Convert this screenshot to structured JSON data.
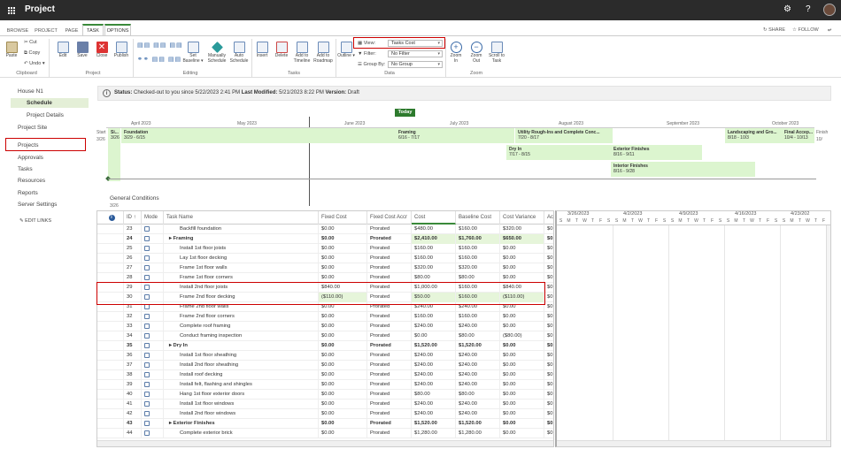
{
  "app": {
    "title": "Project"
  },
  "tabs": [
    "BROWSE",
    "PROJECT",
    "PAGE",
    "TASK",
    "OPTIONS"
  ],
  "tab_right": {
    "share": "SHARE",
    "follow": "FOLLOW"
  },
  "ribbon": {
    "clipboard": {
      "paste": "Paste",
      "cut": "Cut",
      "copy": "Copy",
      "undo": "Undo",
      "label": "Clipboard"
    },
    "project": {
      "edit": "Edit",
      "save": "Save",
      "close": "Close",
      "publish": "Publish",
      "label": "Project"
    },
    "editing": {
      "set_baseline": "Set Baseline",
      "manually": "Manually Schedule",
      "auto": "Auto Schedule",
      "label": "Editing"
    },
    "tasks": {
      "insert": "Insert",
      "delete": "Delete",
      "add_timeline": "Add to Timeline",
      "add_roadmap": "Add to Roadmap",
      "label": "Tasks"
    },
    "data": {
      "outline": "Outline",
      "view_label": "View:",
      "view_value": "Tasks Cost",
      "filter_label": "Filter:",
      "filter_value": "No Filter",
      "group_label": "Group By:",
      "group_value": "No Group",
      "label": "Data"
    },
    "zoom": {
      "zoom_in": "Zoom In",
      "zoom_out": "Zoom Out",
      "scroll": "Scroll to Task",
      "label": "Zoom"
    }
  },
  "nav": {
    "items": [
      "House N1",
      "Schedule",
      "Project Details",
      "Project Site",
      "Projects",
      "Approvals",
      "Tasks",
      "Resources",
      "Reports",
      "Server Settings",
      "EDIT LINKS"
    ]
  },
  "status": {
    "l1": "Status:",
    "v1": "Checked-out to you since 5/22/2023 2:41 PM",
    "l2": "Last Modified:",
    "v2": "5/21/2023 8:22 PM",
    "l3": "Version:",
    "v3": "Draft"
  },
  "timeline": {
    "today": "Today",
    "start_label": "Start",
    "start_date": "3/26",
    "finish_label": "Finish",
    "finish_date": "10/",
    "months": [
      "April 2023",
      "May 2023",
      "June 2023",
      "July 2023",
      "August 2023",
      "September 2023",
      "October 2023"
    ],
    "bars": [
      {
        "name": "Si...",
        "date": "3/26"
      },
      {
        "name": "Foundation",
        "date": "3/29 - 6/15"
      },
      {
        "name": "Framing",
        "date": "6/16 - 7/17"
      },
      {
        "name": "Utility Rough-Ins and Complete Conc...",
        "date": "7/20 - 8/17"
      },
      {
        "name": "Landscaping and Gro...",
        "date": "8/18 - 10/3"
      },
      {
        "name": "Final Accep...",
        "date": "10/4 - 10/13"
      },
      {
        "name": "Dry In",
        "date": "7/17 - 8/15"
      },
      {
        "name": "Exterior Finishes",
        "date": "8/16 - 9/11"
      },
      {
        "name": "Interior Finishes",
        "date": "8/16 - 9/28"
      }
    ],
    "general": "General Conditions",
    "general_date": "3/26"
  },
  "grid": {
    "headers": [
      "",
      "ID ↑",
      "Mode",
      "Task Name",
      "Fixed Cost",
      "Fixed Cost Accr",
      "Cost",
      "Baseline Cost",
      "Cost Variance",
      "Ac"
    ],
    "rows": [
      {
        "id": "23",
        "name": "Backfill foundation",
        "fc": "$0.00",
        "acc": "Prorated",
        "cost": "$480.00",
        "base": "$160.00",
        "var": "$320.00",
        "ac": "$0."
      },
      {
        "id": "24",
        "name": "▸ Framing",
        "fc": "$0.00",
        "acc": "Prorated",
        "cost": "$2,410.00",
        "base": "$1,760.00",
        "var": "$650.00",
        "ac": "$0.",
        "bold": true,
        "hl": true
      },
      {
        "id": "25",
        "name": "Install 1st floor joists",
        "fc": "$0.00",
        "acc": "Prorated",
        "cost": "$160.00",
        "base": "$160.00",
        "var": "$0.00",
        "ac": "$0."
      },
      {
        "id": "26",
        "name": "Lay 1st floor decking",
        "fc": "$0.00",
        "acc": "Prorated",
        "cost": "$160.00",
        "base": "$160.00",
        "var": "$0.00",
        "ac": "$0."
      },
      {
        "id": "27",
        "name": "Frame 1st floor walls",
        "fc": "$0.00",
        "acc": "Prorated",
        "cost": "$320.00",
        "base": "$320.00",
        "var": "$0.00",
        "ac": "$0."
      },
      {
        "id": "28",
        "name": "Frame 1st floor corners",
        "fc": "$0.00",
        "acc": "Prorated",
        "cost": "$80.00",
        "base": "$80.00",
        "var": "$0.00",
        "ac": "$0."
      },
      {
        "id": "29",
        "name": "Install 2nd floor joists",
        "fc": "$840.00",
        "acc": "Prorated",
        "cost": "$1,000.00",
        "base": "$160.00",
        "var": "$840.00",
        "ac": "$0."
      },
      {
        "id": "30",
        "name": "Frame 2nd floor decking",
        "fc": "($110.00)",
        "acc": "Prorated",
        "cost": "$50.00",
        "base": "$160.00",
        "var": "($110.00)",
        "ac": "$0.",
        "hl2": true
      },
      {
        "id": "31",
        "name": "Frame 2nd floor walls",
        "fc": "$0.00",
        "acc": "Prorated",
        "cost": "$240.00",
        "base": "$240.00",
        "var": "$0.00",
        "ac": "$0."
      },
      {
        "id": "32",
        "name": "Frame 2nd floor corners",
        "fc": "$0.00",
        "acc": "Prorated",
        "cost": "$160.00",
        "base": "$160.00",
        "var": "$0.00",
        "ac": "$0."
      },
      {
        "id": "33",
        "name": "Complete roof framing",
        "fc": "$0.00",
        "acc": "Prorated",
        "cost": "$240.00",
        "base": "$240.00",
        "var": "$0.00",
        "ac": "$0."
      },
      {
        "id": "34",
        "name": "Conduct framing inspection",
        "fc": "$0.00",
        "acc": "Prorated",
        "cost": "$0.00",
        "base": "$80.00",
        "var": "($80.00)",
        "ac": "$0."
      },
      {
        "id": "35",
        "name": "▸ Dry In",
        "fc": "$0.00",
        "acc": "Prorated",
        "cost": "$1,520.00",
        "base": "$1,520.00",
        "var": "$0.00",
        "ac": "$0.",
        "bold": true
      },
      {
        "id": "36",
        "name": "Install 1st floor sheathing",
        "fc": "$0.00",
        "acc": "Prorated",
        "cost": "$240.00",
        "base": "$240.00",
        "var": "$0.00",
        "ac": "$0."
      },
      {
        "id": "37",
        "name": "Install 2nd floor sheathing",
        "fc": "$0.00",
        "acc": "Prorated",
        "cost": "$240.00",
        "base": "$240.00",
        "var": "$0.00",
        "ac": "$0."
      },
      {
        "id": "38",
        "name": "Install roof decking",
        "fc": "$0.00",
        "acc": "Prorated",
        "cost": "$240.00",
        "base": "$240.00",
        "var": "$0.00",
        "ac": "$0."
      },
      {
        "id": "39",
        "name": "Install felt, flashing and shingles",
        "fc": "$0.00",
        "acc": "Prorated",
        "cost": "$240.00",
        "base": "$240.00",
        "var": "$0.00",
        "ac": "$0."
      },
      {
        "id": "40",
        "name": "Hang 1st floor exterior doors",
        "fc": "$0.00",
        "acc": "Prorated",
        "cost": "$80.00",
        "base": "$80.00",
        "var": "$0.00",
        "ac": "$0."
      },
      {
        "id": "41",
        "name": "Install 1st floor windows",
        "fc": "$0.00",
        "acc": "Prorated",
        "cost": "$240.00",
        "base": "$240.00",
        "var": "$0.00",
        "ac": "$0."
      },
      {
        "id": "42",
        "name": "Install 2nd floor windows",
        "fc": "$0.00",
        "acc": "Prorated",
        "cost": "$240.00",
        "base": "$240.00",
        "var": "$0.00",
        "ac": "$0."
      },
      {
        "id": "43",
        "name": "▸ Exterior Finishes",
        "fc": "$0.00",
        "acc": "Prorated",
        "cost": "$1,520.00",
        "base": "$1,520.00",
        "var": "$0.00",
        "ac": "$0.",
        "bold": true
      },
      {
        "id": "44",
        "name": "Complete exterior brick",
        "fc": "$0.00",
        "acc": "Prorated",
        "cost": "$1,280.00",
        "base": "$1,280.00",
        "var": "$0.00",
        "ac": "$0."
      }
    ]
  },
  "gantt": {
    "weeks": [
      "3/26/2023",
      "4/2/2023",
      "4/9/2023",
      "4/16/2023",
      "4/23/202"
    ],
    "days": [
      "S",
      "M",
      "T",
      "W",
      "T",
      "F",
      "S"
    ]
  },
  "colors": {
    "accent": "#2d7a2d",
    "highlight": "#e6f5da",
    "timeline_bar": "#dcf5cf",
    "red_box": "#cc0000"
  }
}
